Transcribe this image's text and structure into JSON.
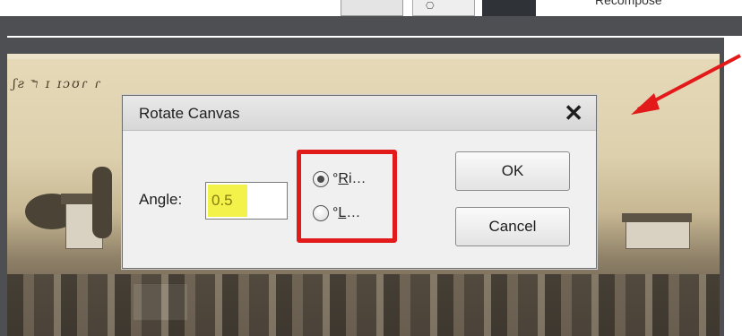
{
  "toolbar": {
    "partial_label_left": "",
    "partial_label": "Recompose"
  },
  "dialog": {
    "title": "Rotate Canvas",
    "angle_label": "Angle:",
    "angle_value": "0.5",
    "radio_right": {
      "prefix": "°",
      "underlined": "R",
      "rest": "i…"
    },
    "radio_left": {
      "prefix": "°",
      "underlined": "L",
      "rest": "…"
    },
    "ok_label": "OK",
    "cancel_label": "Cancel",
    "close_glyph": "✕"
  },
  "photo": {
    "handwriting": "ʃƨ ר̄ ɪ ɪɔʊɾ ɾ"
  },
  "colors": {
    "highlight": "#e21a1a",
    "angle_highlight": "#f2f24a",
    "workspace": "#4d4f52"
  },
  "icons": {
    "close": "close-icon",
    "annotation_arrow": "red-arrow-icon"
  }
}
